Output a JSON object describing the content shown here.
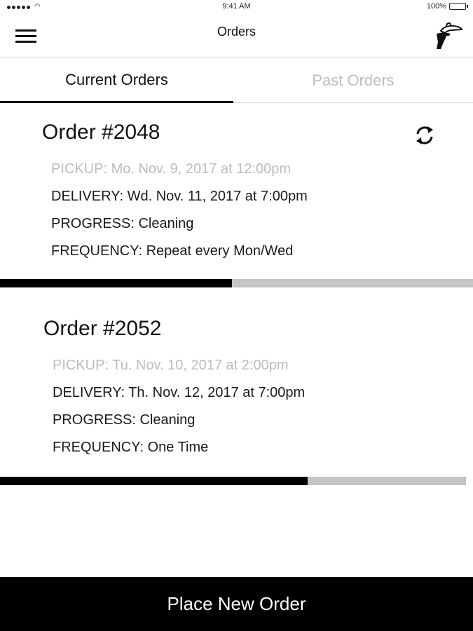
{
  "status_bar": {
    "time": "9:41 AM",
    "battery": "100%"
  },
  "nav": {
    "title": "Orders",
    "menu_icon": "hamburger-menu-icon",
    "logo_icon": "hand-holding-hanger-icon"
  },
  "tabs": [
    {
      "label": "Current Orders",
      "active": true
    },
    {
      "label": "Past Orders",
      "active": false
    }
  ],
  "orders": [
    {
      "title": "Order #2048",
      "pickup": "PICKUP: Mo. Nov. 9, 2017 at 12:00pm",
      "delivery": "DELIVERY: Wd. Nov. 11, 2017 at 7:00pm",
      "progress": "PROGRESS: Cleaning",
      "frequency": "FREQUENCY: Repeat every Mon/Wed",
      "recurring_icon": "refresh-icon",
      "progress_fraction": 0.49
    },
    {
      "title": "Order #2052",
      "pickup": "PICKUP: Tu. Nov. 10, 2017 at 2:00pm",
      "delivery": "DELIVERY: Th. Nov. 12, 2017 at 7:00pm",
      "progress": "PROGRESS: Cleaning",
      "frequency": "FREQUENCY: One Time",
      "progress_fraction": 0.66
    }
  ],
  "actions": {
    "place_order": "Place New Order"
  },
  "colors": {
    "primary": "#000000",
    "muted_text": "#bcbcbc",
    "progress_track": "#c4c4c4"
  }
}
